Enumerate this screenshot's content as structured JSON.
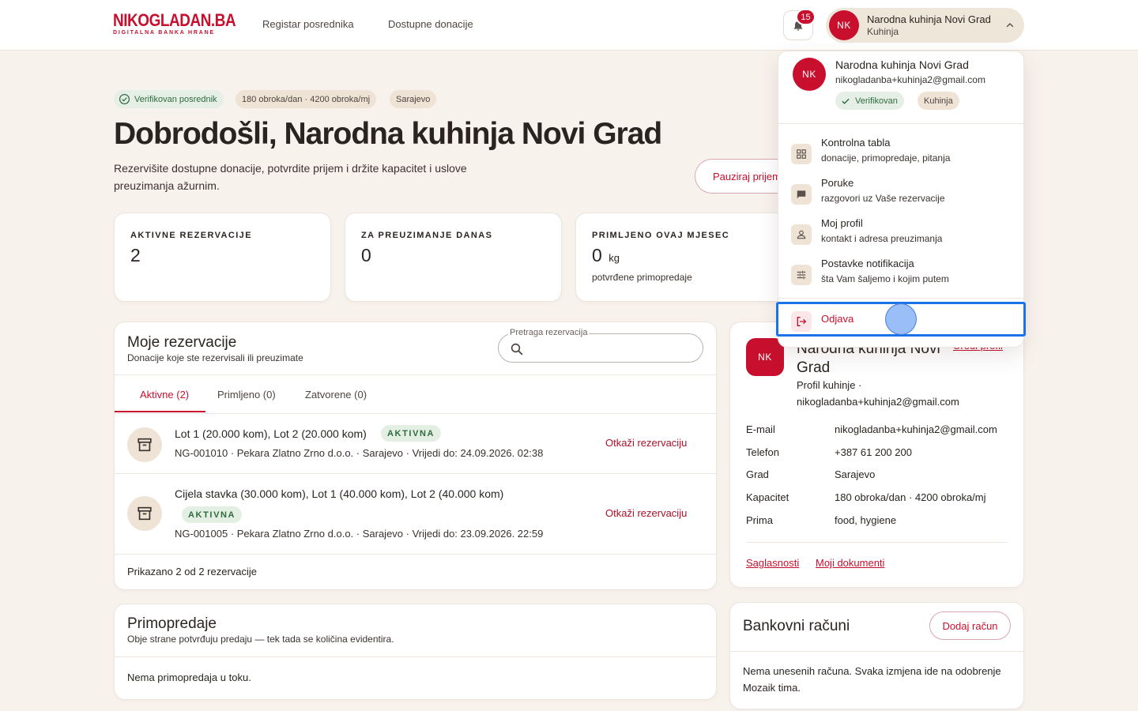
{
  "header": {
    "logo_main": "NIKOGLADAN.BA",
    "logo_sub": "DIGITALNA BANKA HRANE",
    "nav": [
      "Registar posrednika",
      "Dostupne donacije"
    ],
    "notification_count": "15",
    "user": {
      "initials": "NK",
      "name": "Narodna kuhinja Novi Grad",
      "role": "Kuhinja"
    }
  },
  "hero": {
    "badges": [
      "Verifikovan posrednik",
      "180 obroka/dan · 4200 obroka/mj",
      "Sarajevo"
    ],
    "title": "Dobrodošli, Narodna kuhinja Novi Grad",
    "subtitle": "Rezervišite dostupne donacije, potvrdite prijem i držite kapacitet i uslove preuzimanja ažurnim.",
    "pause_button": "Pauziraj prijem"
  },
  "stats": [
    {
      "label": "AKTIVNE REZERVACIJE",
      "value": "2"
    },
    {
      "label": "ZA PREUZIMANJE DANAS",
      "value": "0"
    },
    {
      "label": "PRIMLJENO OVAJ MJESEC",
      "value": "0",
      "unit": "kg",
      "note": "potvrđene primopredaje"
    }
  ],
  "reservations": {
    "title": "Moje rezervacije",
    "subtitle": "Donacije koje ste rezervisali ili preuzimate",
    "search_label": "Pretraga rezervacija",
    "search_value": "",
    "tabs": [
      "Aktivne (2)",
      "Primljeno (0)",
      "Zatvorene (0)"
    ],
    "items": [
      {
        "title": "Lot 1 (20.000 kom), Lot 2 (20.000 kom)",
        "status": "AKTIVNA",
        "meta": "NG-001010 · Pekara Zlatno Zrno d.o.o. · Sarajevo · Vrijedi do: 24.09.2026. 02:38",
        "action": "Otkaži rezervaciju"
      },
      {
        "title": "Cijela stavka (30.000 kom), Lot 1 (40.000 kom), Lot 2 (40.000 kom)",
        "status": "AKTIVNA",
        "meta": "NG-001005 · Pekara Zlatno Zrno d.o.o. · Sarajevo · Vrijedi do: 23.09.2026. 22:59",
        "action": "Otkaži rezervaciju"
      }
    ],
    "footer": "Prikazano 2 od 2 rezervacije"
  },
  "handovers": {
    "title": "Primopredaje",
    "subtitle": "Obje strane potvrđuju predaju — tek tada se količina evidentira.",
    "empty": "Nema primopredaja u toku."
  },
  "profile": {
    "initials": "NK",
    "name_line1": "Narodna kuhinja Novi",
    "name_line2": "Grad",
    "edit_link": "Uredi profil",
    "desc_line1": "Profil kuhinje ·",
    "desc_line2": "nikogladanba+kuhinja2@gmail.com",
    "fields": [
      {
        "key": "E-mail",
        "value": "nikogladanba+kuhinja2@gmail.com"
      },
      {
        "key": "Telefon",
        "value": "+387 61 200 200"
      },
      {
        "key": "Grad",
        "value": "Sarajevo"
      },
      {
        "key": "Kapacitet",
        "value": "180 obroka/dan · 4200 obroka/mj"
      },
      {
        "key": "Prima",
        "value": "food, hygiene"
      }
    ],
    "links": [
      "Saglasnosti",
      "Moji dokumenti"
    ]
  },
  "bank": {
    "title": "Bankovni računi",
    "add_button": "Dodaj račun",
    "empty_line1": "Nema unesenih računa. Svaka izmjena ide na odobrenje",
    "empty_line2": "Mozaik tima."
  },
  "dropdown": {
    "initials": "NK",
    "name": "Narodna kuhinja Novi Grad",
    "email": "nikogladanba+kuhinja2@gmail.com",
    "pills": [
      "Verifikovan",
      "Kuhinja"
    ],
    "items": [
      {
        "label": "Kontrolna tabla",
        "desc": "donacije, primopredaje, pitanja",
        "icon": "dashboard-icon"
      },
      {
        "label": "Poruke",
        "desc": "razgovori uz Vaše rezervacije",
        "icon": "chat-icon"
      },
      {
        "label": "Moj profil",
        "desc": "kontakt i adresa preuzimanja",
        "icon": "user-icon"
      },
      {
        "label": "Postavke notifikacija",
        "desc": "šta Vam šaljemo i kojim putem",
        "icon": "sliders-icon"
      }
    ],
    "logout": "Odjava"
  },
  "colors": {
    "brand": "#c8102e",
    "background": "#f8f2ed",
    "success": "#2e6b3f",
    "focus": "#1a73e8"
  }
}
